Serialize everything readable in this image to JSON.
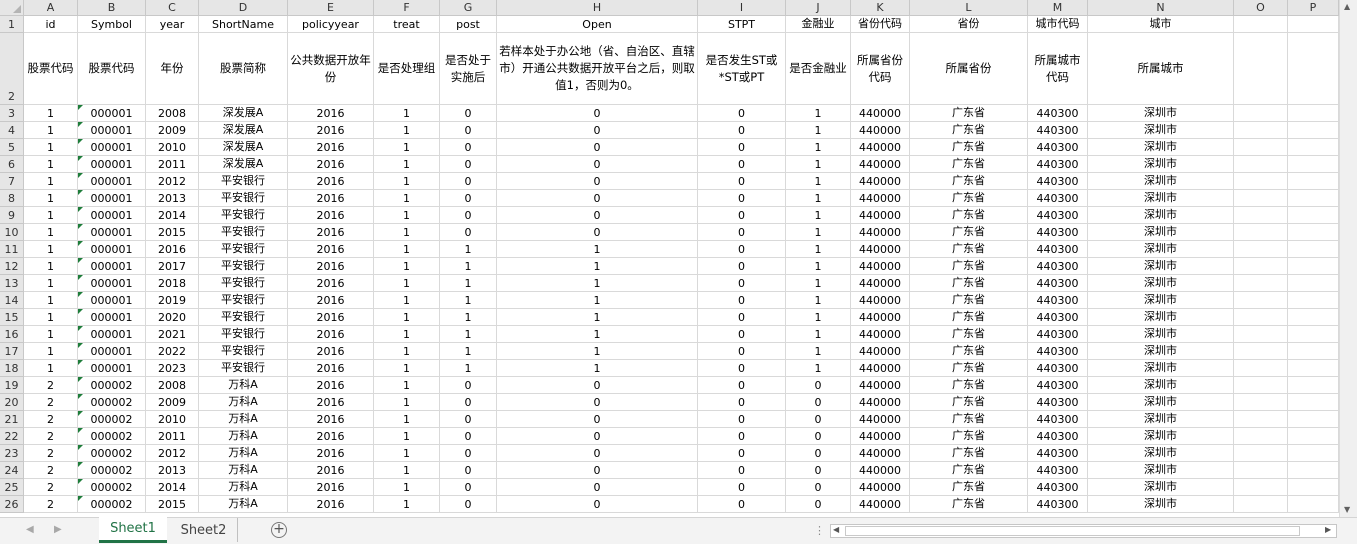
{
  "columns": [
    "A",
    "B",
    "C",
    "D",
    "E",
    "F",
    "G",
    "H",
    "I",
    "J",
    "K",
    "L",
    "M",
    "N",
    "O",
    "P"
  ],
  "header_row1": [
    "id",
    "Symbol",
    "year",
    "ShortName",
    "policyyear",
    "treat",
    "post",
    "Open",
    "STPT",
    "金融业",
    "省份代码",
    "省份",
    "城市代码",
    "城市",
    "",
    ""
  ],
  "header_row2": [
    "股票代码",
    "股票代码",
    "年份",
    "股票简称",
    "公共数据开放年份",
    "是否处理组",
    "是否处于实施后",
    "若样本处于办公地（省、自治区、直辖市）开通公共数据开放平台之后，则取值1，否则为0。",
    "是否发生ST或*ST或PT",
    "是否金融业",
    "所属省份代码",
    "所属省份",
    "所属城市代码",
    "所属城市",
    "",
    ""
  ],
  "row_numbers": [
    "1",
    "2",
    "3",
    "4",
    "5",
    "6",
    "7",
    "8",
    "9",
    "10",
    "11",
    "12",
    "13",
    "14",
    "15",
    "16",
    "17",
    "18",
    "19",
    "20",
    "21",
    "22",
    "23",
    "24",
    "25",
    "26"
  ],
  "rows": [
    [
      "1",
      "000001",
      "2008",
      "深发展A",
      "2016",
      "1",
      "0",
      "0",
      "0",
      "1",
      "440000",
      "广东省",
      "440300",
      "深圳市"
    ],
    [
      "1",
      "000001",
      "2009",
      "深发展A",
      "2016",
      "1",
      "0",
      "0",
      "0",
      "1",
      "440000",
      "广东省",
      "440300",
      "深圳市"
    ],
    [
      "1",
      "000001",
      "2010",
      "深发展A",
      "2016",
      "1",
      "0",
      "0",
      "0",
      "1",
      "440000",
      "广东省",
      "440300",
      "深圳市"
    ],
    [
      "1",
      "000001",
      "2011",
      "深发展A",
      "2016",
      "1",
      "0",
      "0",
      "0",
      "1",
      "440000",
      "广东省",
      "440300",
      "深圳市"
    ],
    [
      "1",
      "000001",
      "2012",
      "平安银行",
      "2016",
      "1",
      "0",
      "0",
      "0",
      "1",
      "440000",
      "广东省",
      "440300",
      "深圳市"
    ],
    [
      "1",
      "000001",
      "2013",
      "平安银行",
      "2016",
      "1",
      "0",
      "0",
      "0",
      "1",
      "440000",
      "广东省",
      "440300",
      "深圳市"
    ],
    [
      "1",
      "000001",
      "2014",
      "平安银行",
      "2016",
      "1",
      "0",
      "0",
      "0",
      "1",
      "440000",
      "广东省",
      "440300",
      "深圳市"
    ],
    [
      "1",
      "000001",
      "2015",
      "平安银行",
      "2016",
      "1",
      "0",
      "0",
      "0",
      "1",
      "440000",
      "广东省",
      "440300",
      "深圳市"
    ],
    [
      "1",
      "000001",
      "2016",
      "平安银行",
      "2016",
      "1",
      "1",
      "1",
      "0",
      "1",
      "440000",
      "广东省",
      "440300",
      "深圳市"
    ],
    [
      "1",
      "000001",
      "2017",
      "平安银行",
      "2016",
      "1",
      "1",
      "1",
      "0",
      "1",
      "440000",
      "广东省",
      "440300",
      "深圳市"
    ],
    [
      "1",
      "000001",
      "2018",
      "平安银行",
      "2016",
      "1",
      "1",
      "1",
      "0",
      "1",
      "440000",
      "广东省",
      "440300",
      "深圳市"
    ],
    [
      "1",
      "000001",
      "2019",
      "平安银行",
      "2016",
      "1",
      "1",
      "1",
      "0",
      "1",
      "440000",
      "广东省",
      "440300",
      "深圳市"
    ],
    [
      "1",
      "000001",
      "2020",
      "平安银行",
      "2016",
      "1",
      "1",
      "1",
      "0",
      "1",
      "440000",
      "广东省",
      "440300",
      "深圳市"
    ],
    [
      "1",
      "000001",
      "2021",
      "平安银行",
      "2016",
      "1",
      "1",
      "1",
      "0",
      "1",
      "440000",
      "广东省",
      "440300",
      "深圳市"
    ],
    [
      "1",
      "000001",
      "2022",
      "平安银行",
      "2016",
      "1",
      "1",
      "1",
      "0",
      "1",
      "440000",
      "广东省",
      "440300",
      "深圳市"
    ],
    [
      "1",
      "000001",
      "2023",
      "平安银行",
      "2016",
      "1",
      "1",
      "1",
      "0",
      "1",
      "440000",
      "广东省",
      "440300",
      "深圳市"
    ],
    [
      "2",
      "000002",
      "2008",
      "万科A",
      "2016",
      "1",
      "0",
      "0",
      "0",
      "0",
      "440000",
      "广东省",
      "440300",
      "深圳市"
    ],
    [
      "2",
      "000002",
      "2009",
      "万科A",
      "2016",
      "1",
      "0",
      "0",
      "0",
      "0",
      "440000",
      "广东省",
      "440300",
      "深圳市"
    ],
    [
      "2",
      "000002",
      "2010",
      "万科A",
      "2016",
      "1",
      "0",
      "0",
      "0",
      "0",
      "440000",
      "广东省",
      "440300",
      "深圳市"
    ],
    [
      "2",
      "000002",
      "2011",
      "万科A",
      "2016",
      "1",
      "0",
      "0",
      "0",
      "0",
      "440000",
      "广东省",
      "440300",
      "深圳市"
    ],
    [
      "2",
      "000002",
      "2012",
      "万科A",
      "2016",
      "1",
      "0",
      "0",
      "0",
      "0",
      "440000",
      "广东省",
      "440300",
      "深圳市"
    ],
    [
      "2",
      "000002",
      "2013",
      "万科A",
      "2016",
      "1",
      "0",
      "0",
      "0",
      "0",
      "440000",
      "广东省",
      "440300",
      "深圳市"
    ],
    [
      "2",
      "000002",
      "2014",
      "万科A",
      "2016",
      "1",
      "0",
      "0",
      "0",
      "0",
      "440000",
      "广东省",
      "440300",
      "深圳市"
    ],
    [
      "2",
      "000002",
      "2015",
      "万科A",
      "2016",
      "1",
      "0",
      "0",
      "0",
      "0",
      "440000",
      "广东省",
      "440300",
      "深圳市"
    ]
  ],
  "sheets": [
    {
      "label": "Sheet1",
      "active": true
    },
    {
      "label": "Sheet2",
      "active": false
    }
  ],
  "icons": {
    "add_sheet": "plus-circle-icon",
    "nav_prev": "triangle-left-icon",
    "nav_next": "triangle-right-icon",
    "error_indicator": "green-triangle-icon"
  },
  "colors": {
    "accent": "#217346",
    "error_triangle": "#1e7d3a",
    "header_bg": "#e6e6e6",
    "gridline": "#d9d9d9"
  }
}
